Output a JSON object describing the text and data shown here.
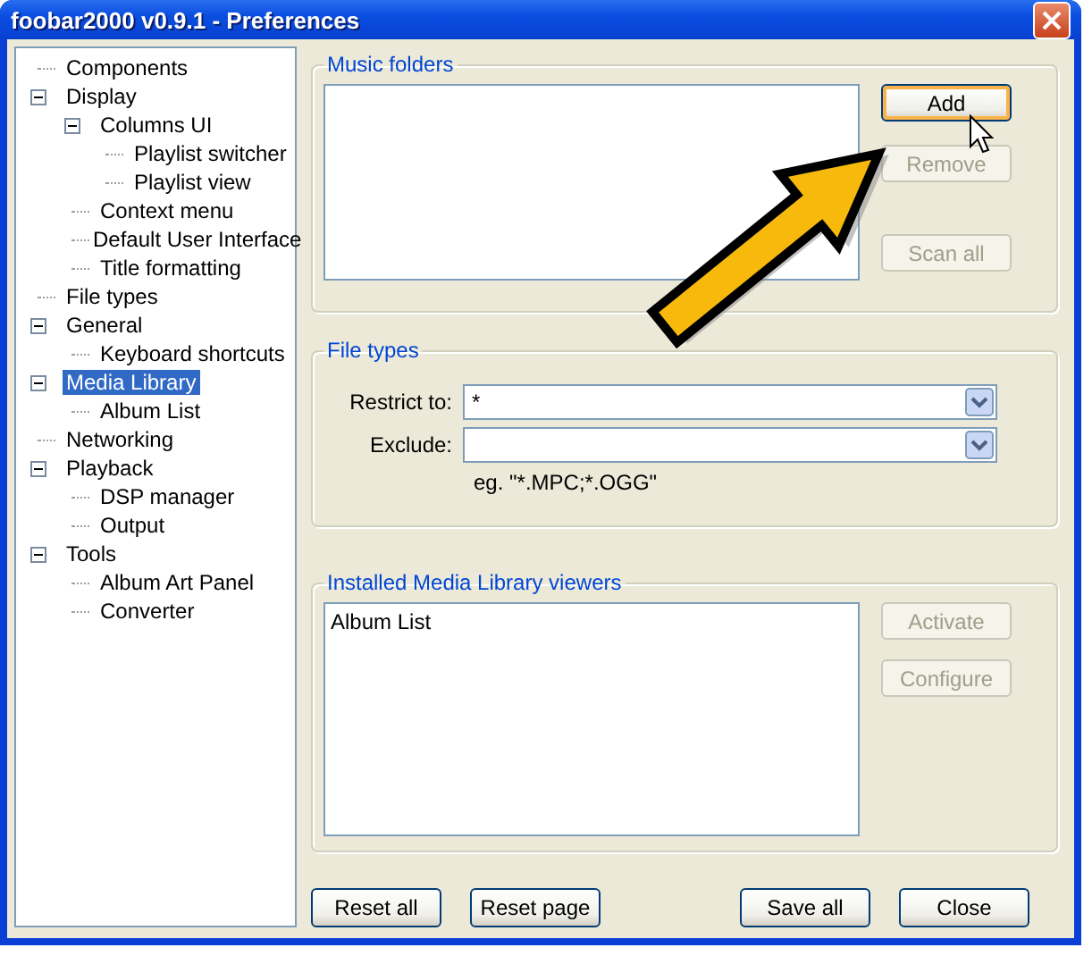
{
  "window": {
    "title": "foobar2000 v0.9.1 - Preferences"
  },
  "tree": [
    {
      "label": "Components",
      "selected": false
    },
    {
      "label": "Display",
      "selected": false,
      "expanded": true,
      "children": [
        {
          "label": "Columns UI",
          "selected": false,
          "expanded": true,
          "children": [
            {
              "label": "Playlist switcher",
              "selected": false
            },
            {
              "label": "Playlist view",
              "selected": false
            }
          ]
        },
        {
          "label": "Context menu",
          "selected": false
        },
        {
          "label": "Default User Interface",
          "selected": false
        },
        {
          "label": "Title formatting",
          "selected": false
        }
      ]
    },
    {
      "label": "File types",
      "selected": false
    },
    {
      "label": "General",
      "selected": false,
      "expanded": true,
      "children": [
        {
          "label": "Keyboard shortcuts",
          "selected": false
        }
      ]
    },
    {
      "label": "Media Library",
      "selected": true,
      "expanded": true,
      "children": [
        {
          "label": "Album List",
          "selected": false
        }
      ]
    },
    {
      "label": "Networking",
      "selected": false
    },
    {
      "label": "Playback",
      "selected": false,
      "expanded": true,
      "children": [
        {
          "label": "DSP manager",
          "selected": false
        },
        {
          "label": "Output",
          "selected": false
        }
      ]
    },
    {
      "label": "Tools",
      "selected": false,
      "expanded": true,
      "children": [
        {
          "label": "Album Art Panel",
          "selected": false
        },
        {
          "label": "Converter",
          "selected": false
        }
      ]
    }
  ],
  "music_folders": {
    "title": "Music folders",
    "buttons": [
      {
        "label": "Add",
        "disabled": false,
        "hovered": true
      },
      {
        "label": "Remove",
        "disabled": true,
        "hovered": false
      },
      {
        "label": "Scan all",
        "disabled": true,
        "hovered": false
      }
    ]
  },
  "file_types": {
    "title": "File types",
    "fields": [
      {
        "label": "Restrict to:",
        "value": "*"
      },
      {
        "label": "Exclude:"
      }
    ],
    "hint": "eg. \"*.MPC;*.OGG\""
  },
  "viewers": {
    "title": "Installed Media Library viewers",
    "items": [
      "Album List"
    ],
    "buttons": [
      {
        "label": "Activate",
        "disabled": true,
        "hovered": false
      },
      {
        "label": "Configure",
        "disabled": true,
        "hovered": false
      }
    ]
  },
  "footer_buttons": [
    {
      "label": "Reset all",
      "disabled": false,
      "hovered": false
    },
    {
      "label": "Reset page",
      "disabled": false,
      "hovered": false
    },
    {
      "label": "Save all",
      "disabled": false,
      "hovered": false
    },
    {
      "label": "Close",
      "disabled": false,
      "hovered": false
    }
  ]
}
